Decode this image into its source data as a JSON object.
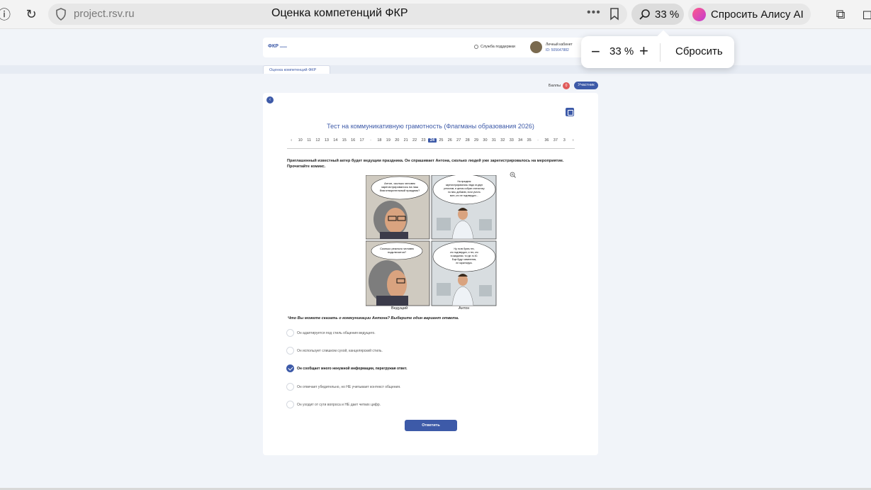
{
  "browser": {
    "url": "project.rsv.ru",
    "tab_title": "Оценка компетенций ФКР",
    "zoom_label": "33 %",
    "alice_label": "Спросить Алису AI"
  },
  "zoom_popup": {
    "minus": "−",
    "value": "33 %",
    "plus": "+",
    "reset_label": "Сбросить"
  },
  "header": {
    "logo": "ФКР",
    "support_label": "Служба поддержки",
    "cabinet_label": "Личный кабинет",
    "cabinet_id": "ID: 505647882"
  },
  "tab": {
    "label": "Оценка компетенций ФКР"
  },
  "score": {
    "label": "Баллы",
    "value": "0",
    "role": "Участник"
  },
  "test": {
    "title": "Тест на коммуникативную грамотность (Флагманы образования 2026)",
    "question_numbers": [
      "‹",
      "10",
      "11",
      "12",
      "13",
      "14",
      "15",
      "16",
      "17",
      "·",
      "18",
      "19",
      "20",
      "21",
      "22",
      "23",
      "24",
      "25",
      "26",
      "27",
      "28",
      "29",
      "30",
      "31",
      "32",
      "33",
      "34",
      "35",
      "·",
      "36",
      "37",
      "3",
      "›"
    ],
    "current_question": "24",
    "question_text": "Приглашенный известный актер будет ведущим праздника. Он спрашивает Антона, сколько людей уже зарегистрировалось на мероприятие. Прочитайте комикс.",
    "bubble_1": "Антон, сколько человек зарегистрировалось на наш благотворительный праздник?",
    "bubble_2": "На праздник зарегистрировались люди из двух регионов, в целом собрал статистику по ним…",
    "bubble_3": "Сколько реально человек подключится?",
    "bubble_4": "Ну, если брать тех, кто подтвердил, и тех, кто в ожидании, то где-то 40.",
    "caption_left": "Ведущий",
    "caption_right": "Антон",
    "ask": "Что Вы можете сказать о коммуникации Антона? Выберите один вариант ответа.",
    "options": [
      "Он адаптируется под стиль общения ведущего.",
      "Он использует слишком сухой, канцелярский стиль.",
      "Он сообщает много ненужной информации, перегружая ответ.",
      "Он отвечает убедительно, но НЕ учитывает контекст общения.",
      "Он уходит от сути вопроса и НЕ дает четких цифр."
    ],
    "selected_option": 2,
    "submit_label": "Ответить"
  },
  "colors": {
    "brand": "#3d5aa8",
    "page_bg": "#f1f4f9"
  }
}
